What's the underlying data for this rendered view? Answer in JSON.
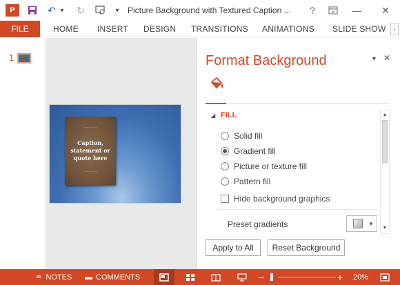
{
  "app": {
    "icon_letter": "P"
  },
  "qat": {
    "undo_icon": "↶",
    "redo_icon": "↻",
    "dropdown_icon": "▾"
  },
  "window": {
    "title": "Picture Background with Textured Caption ...",
    "help": "?",
    "minimize": "—",
    "close": "✕"
  },
  "ribbon": {
    "file": "FILE",
    "tabs": [
      "HOME",
      "INSERT",
      "DESIGN",
      "TRANSITIONS",
      "ANIMATIONS",
      "SLIDE SHOW"
    ],
    "scroll": "›"
  },
  "thumbnails": {
    "slide_number": "1"
  },
  "slide": {
    "caption": "Caption,\nstatement or\nquote here"
  },
  "pane": {
    "title": "Format Background",
    "section": "FILL",
    "options": [
      {
        "label": "Solid fill",
        "selected": false
      },
      {
        "label": "Gradient fill",
        "selected": true
      },
      {
        "label": "Picture or texture fill",
        "selected": false
      },
      {
        "label": "Pattern fill",
        "selected": false
      }
    ],
    "hide_graphics": {
      "label": "Hide background graphics",
      "checked": false
    },
    "preset_label": "Preset gradients",
    "apply_all": "Apply to All",
    "reset": "Reset Background"
  },
  "statusbar": {
    "notes": "NOTES",
    "comments": "COMMENTS",
    "zoom_level": "20%",
    "zoom_minus": "−",
    "zoom_plus": "+"
  },
  "colors": {
    "accent": "#d24726"
  }
}
